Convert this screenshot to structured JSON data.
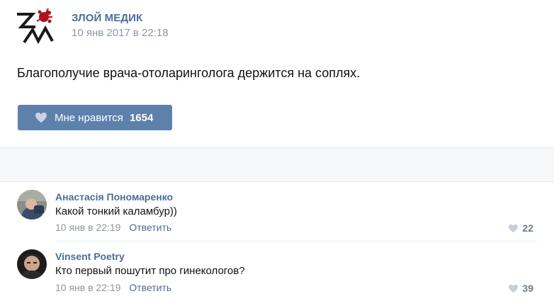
{
  "post": {
    "author": "ЗЛОЙ МЕДИК",
    "date": "10 янв 2017 в 22:18",
    "text": "Благополучие врача-отоларинголога держится на соплях.",
    "like_label": "Мне нравится",
    "like_count": "1654",
    "avatar_letters": "ZM"
  },
  "comments": [
    {
      "author": "Анастасія Пономаренко",
      "text": "Какой тонкий каламбур))",
      "time": "10 янв в 22:19",
      "reply": "Ответить",
      "likes": "22"
    },
    {
      "author": "Vinsent Poetry",
      "text": "Кто первый пошутит про гинекологов?",
      "time": "10 янв в 22:19",
      "reply": "Ответить",
      "likes": "39"
    }
  ],
  "colors": {
    "link": "#4a6e99",
    "button": "#5d81ab",
    "muted": "#8d97a3"
  }
}
